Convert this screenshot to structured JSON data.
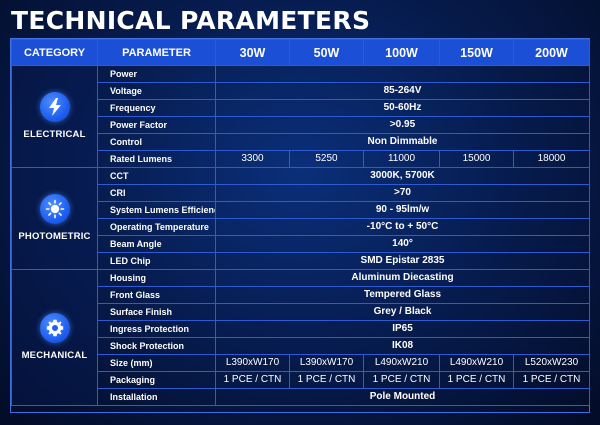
{
  "title": "TECHNICAL PARAMETERS",
  "header": {
    "category": "CATEGORY",
    "parameter": "PARAMETER",
    "wattages": [
      "30W",
      "50W",
      "100W",
      "150W",
      "200W"
    ]
  },
  "sections": [
    {
      "category": "ELECTRICAL",
      "icon": "lightning-icon",
      "rows": [
        {
          "param": "Power",
          "span": ""
        },
        {
          "param": "Voltage",
          "span": "85-264V"
        },
        {
          "param": "Frequency",
          "span": "50-60Hz"
        },
        {
          "param": "Power Factor",
          "span": ">0.95"
        },
        {
          "param": "Control",
          "span": "Non Dimmable"
        },
        {
          "param": "Rated Lumens",
          "values": [
            "3300",
            "5250",
            "11000",
            "15000",
            "18000"
          ]
        }
      ]
    },
    {
      "category": "PHOTOMETRIC",
      "icon": "sun-icon",
      "rows": [
        {
          "param": "CCT",
          "span": "3000K, 5700K"
        },
        {
          "param": "CRI",
          "span": ">70"
        },
        {
          "param": "System Lumens Efficiency",
          "span": "90 - 95lm/w"
        },
        {
          "param": "Operating Temperature",
          "span": "-10°C to + 50°C"
        },
        {
          "param": "Beam Angle",
          "span": "140°"
        },
        {
          "param": "LED Chip",
          "span": "SMD Epistar 2835"
        }
      ]
    },
    {
      "category": "MECHANICAL",
      "icon": "gear-icon",
      "rows": [
        {
          "param": "Housing",
          "span": "Aluminum Diecasting"
        },
        {
          "param": "Front Glass",
          "span": "Tempered Glass"
        },
        {
          "param": "Surface Finish",
          "span": "Grey / Black"
        },
        {
          "param": "Ingress Protection",
          "span": "IP65"
        },
        {
          "param": "Shock Protection",
          "span": "IK08"
        },
        {
          "param": "Size (mm)",
          "values": [
            "L390xW170",
            "L390xW170",
            "L490xW210",
            "L490xW210",
            "L520xW230"
          ]
        },
        {
          "param": "Packaging",
          "values": [
            "1 PCE / CTN",
            "1 PCE / CTN",
            "1 PCE / CTN",
            "1 PCE / CTN",
            "1 PCE / CTN"
          ]
        },
        {
          "param": "Installation",
          "span": "Pole Mounted"
        }
      ]
    }
  ]
}
